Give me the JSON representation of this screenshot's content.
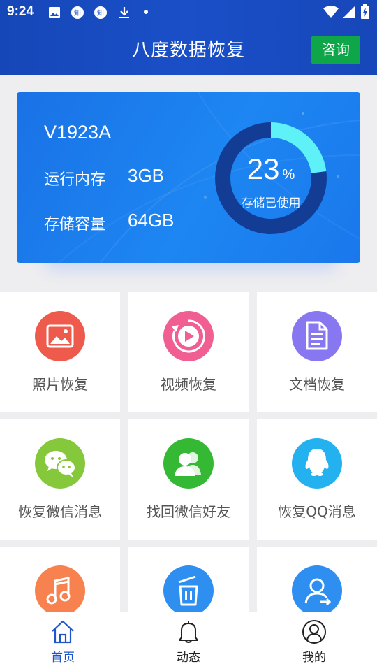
{
  "status_bar": {
    "time": "9:24",
    "icons_left": [
      "image-icon",
      "zhihu-icon",
      "zhihu-icon",
      "download-icon",
      "dot-icon"
    ],
    "icons_right": [
      "wifi-icon",
      "signal-icon",
      "battery-charging-icon"
    ]
  },
  "header": {
    "title": "八度数据恢复",
    "consult_label": "咨询",
    "bg_color": "#1a4fc8",
    "consult_color": "#0fa64a"
  },
  "device": {
    "model": "V1923A",
    "ram_label": "运行内存",
    "ram_value": "3GB",
    "storage_label": "存储容量",
    "storage_value": "64GB",
    "usage_percent": "23",
    "usage_unit": "%",
    "usage_label": "存储已使用",
    "usage_fraction": 0.23,
    "ring_used_color": "#5ef2f8",
    "ring_track_color": "#133c95"
  },
  "features": [
    {
      "label": "照片恢复",
      "icon": "photo-icon",
      "color": "#ee5b4c"
    },
    {
      "label": "视频恢复",
      "icon": "video-play-icon",
      "color": "#f15f92"
    },
    {
      "label": "文档恢复",
      "icon": "document-icon",
      "color": "#8777f0"
    },
    {
      "label": "恢复微信消息",
      "icon": "wechat-icon",
      "color": "#86c83b"
    },
    {
      "label": "找回微信好友",
      "icon": "contacts-icon",
      "color": "#35b935"
    },
    {
      "label": "恢复QQ消息",
      "icon": "qq-icon",
      "color": "#23b1ef"
    },
    {
      "label": "",
      "icon": "music-icon",
      "color": "#f7814f"
    },
    {
      "label": "",
      "icon": "trash-restore-icon",
      "color": "#2e8ff0"
    },
    {
      "label": "",
      "icon": "user-switch-icon",
      "color": "#2e8ff0"
    }
  ],
  "bottom_nav": [
    {
      "label": "首页",
      "icon": "home-icon",
      "active": true
    },
    {
      "label": "动态",
      "icon": "bell-icon",
      "active": false
    },
    {
      "label": "我的",
      "icon": "profile-icon",
      "active": false
    }
  ],
  "colors": {
    "page_bg": "#eeeef0",
    "active_nav": "#1e56c9"
  }
}
